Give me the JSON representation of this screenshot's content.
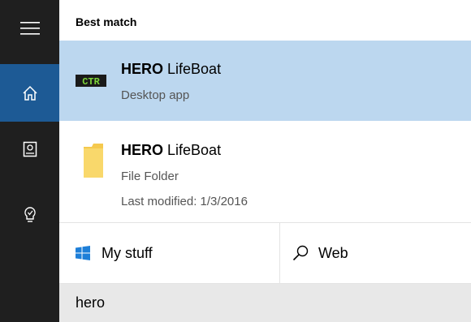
{
  "sidebar": {
    "items": [
      {
        "icon": "hamburger-icon"
      },
      {
        "icon": "home-icon",
        "selected": true
      },
      {
        "icon": "notebook-icon"
      },
      {
        "icon": "lightbulb-icon"
      }
    ]
  },
  "results": {
    "header": "Best match",
    "items": [
      {
        "title_bold": "HERO",
        "title_rest": " LifeBoat",
        "subtitle": "Desktop app",
        "icon": "ctr-app-icon"
      },
      {
        "title_bold": "HERO",
        "title_rest": " LifeBoat",
        "subtitle": "File Folder",
        "detail": "Last modified: 1/3/2016",
        "icon": "folder-icon"
      }
    ]
  },
  "filters": {
    "my_stuff": {
      "label": "My stuff",
      "icon": "windows-logo-icon"
    },
    "web": {
      "label": "Web",
      "icon": "search-icon"
    }
  },
  "search": {
    "value": "hero"
  },
  "colors": {
    "rail": "#1f1f1f",
    "rail_selected": "#1d5a95",
    "selected_row": "#bcd7ef",
    "search_bar": "#e8e8e8",
    "folder": "#f5c94e",
    "windows_logo": "#1e7fd8"
  }
}
